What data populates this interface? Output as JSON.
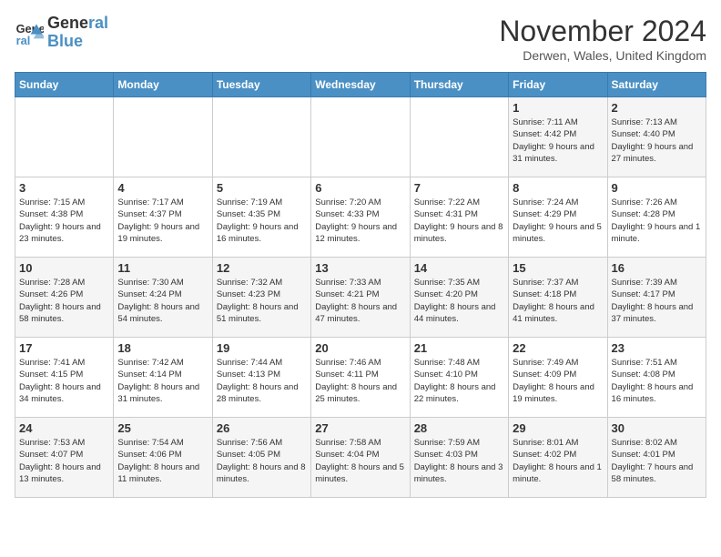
{
  "header": {
    "logo_line1": "General",
    "logo_line2": "Blue",
    "month": "November 2024",
    "location": "Derwen, Wales, United Kingdom"
  },
  "days_of_week": [
    "Sunday",
    "Monday",
    "Tuesday",
    "Wednesday",
    "Thursday",
    "Friday",
    "Saturday"
  ],
  "weeks": [
    [
      {
        "day": "",
        "info": ""
      },
      {
        "day": "",
        "info": ""
      },
      {
        "day": "",
        "info": ""
      },
      {
        "day": "",
        "info": ""
      },
      {
        "day": "",
        "info": ""
      },
      {
        "day": "1",
        "info": "Sunrise: 7:11 AM\nSunset: 4:42 PM\nDaylight: 9 hours and 31 minutes."
      },
      {
        "day": "2",
        "info": "Sunrise: 7:13 AM\nSunset: 4:40 PM\nDaylight: 9 hours and 27 minutes."
      }
    ],
    [
      {
        "day": "3",
        "info": "Sunrise: 7:15 AM\nSunset: 4:38 PM\nDaylight: 9 hours and 23 minutes."
      },
      {
        "day": "4",
        "info": "Sunrise: 7:17 AM\nSunset: 4:37 PM\nDaylight: 9 hours and 19 minutes."
      },
      {
        "day": "5",
        "info": "Sunrise: 7:19 AM\nSunset: 4:35 PM\nDaylight: 9 hours and 16 minutes."
      },
      {
        "day": "6",
        "info": "Sunrise: 7:20 AM\nSunset: 4:33 PM\nDaylight: 9 hours and 12 minutes."
      },
      {
        "day": "7",
        "info": "Sunrise: 7:22 AM\nSunset: 4:31 PM\nDaylight: 9 hours and 8 minutes."
      },
      {
        "day": "8",
        "info": "Sunrise: 7:24 AM\nSunset: 4:29 PM\nDaylight: 9 hours and 5 minutes."
      },
      {
        "day": "9",
        "info": "Sunrise: 7:26 AM\nSunset: 4:28 PM\nDaylight: 9 hours and 1 minute."
      }
    ],
    [
      {
        "day": "10",
        "info": "Sunrise: 7:28 AM\nSunset: 4:26 PM\nDaylight: 8 hours and 58 minutes."
      },
      {
        "day": "11",
        "info": "Sunrise: 7:30 AM\nSunset: 4:24 PM\nDaylight: 8 hours and 54 minutes."
      },
      {
        "day": "12",
        "info": "Sunrise: 7:32 AM\nSunset: 4:23 PM\nDaylight: 8 hours and 51 minutes."
      },
      {
        "day": "13",
        "info": "Sunrise: 7:33 AM\nSunset: 4:21 PM\nDaylight: 8 hours and 47 minutes."
      },
      {
        "day": "14",
        "info": "Sunrise: 7:35 AM\nSunset: 4:20 PM\nDaylight: 8 hours and 44 minutes."
      },
      {
        "day": "15",
        "info": "Sunrise: 7:37 AM\nSunset: 4:18 PM\nDaylight: 8 hours and 41 minutes."
      },
      {
        "day": "16",
        "info": "Sunrise: 7:39 AM\nSunset: 4:17 PM\nDaylight: 8 hours and 37 minutes."
      }
    ],
    [
      {
        "day": "17",
        "info": "Sunrise: 7:41 AM\nSunset: 4:15 PM\nDaylight: 8 hours and 34 minutes."
      },
      {
        "day": "18",
        "info": "Sunrise: 7:42 AM\nSunset: 4:14 PM\nDaylight: 8 hours and 31 minutes."
      },
      {
        "day": "19",
        "info": "Sunrise: 7:44 AM\nSunset: 4:13 PM\nDaylight: 8 hours and 28 minutes."
      },
      {
        "day": "20",
        "info": "Sunrise: 7:46 AM\nSunset: 4:11 PM\nDaylight: 8 hours and 25 minutes."
      },
      {
        "day": "21",
        "info": "Sunrise: 7:48 AM\nSunset: 4:10 PM\nDaylight: 8 hours and 22 minutes."
      },
      {
        "day": "22",
        "info": "Sunrise: 7:49 AM\nSunset: 4:09 PM\nDaylight: 8 hours and 19 minutes."
      },
      {
        "day": "23",
        "info": "Sunrise: 7:51 AM\nSunset: 4:08 PM\nDaylight: 8 hours and 16 minutes."
      }
    ],
    [
      {
        "day": "24",
        "info": "Sunrise: 7:53 AM\nSunset: 4:07 PM\nDaylight: 8 hours and 13 minutes."
      },
      {
        "day": "25",
        "info": "Sunrise: 7:54 AM\nSunset: 4:06 PM\nDaylight: 8 hours and 11 minutes."
      },
      {
        "day": "26",
        "info": "Sunrise: 7:56 AM\nSunset: 4:05 PM\nDaylight: 8 hours and 8 minutes."
      },
      {
        "day": "27",
        "info": "Sunrise: 7:58 AM\nSunset: 4:04 PM\nDaylight: 8 hours and 5 minutes."
      },
      {
        "day": "28",
        "info": "Sunrise: 7:59 AM\nSunset: 4:03 PM\nDaylight: 8 hours and 3 minutes."
      },
      {
        "day": "29",
        "info": "Sunrise: 8:01 AM\nSunset: 4:02 PM\nDaylight: 8 hours and 1 minute."
      },
      {
        "day": "30",
        "info": "Sunrise: 8:02 AM\nSunset: 4:01 PM\nDaylight: 7 hours and 58 minutes."
      }
    ]
  ]
}
